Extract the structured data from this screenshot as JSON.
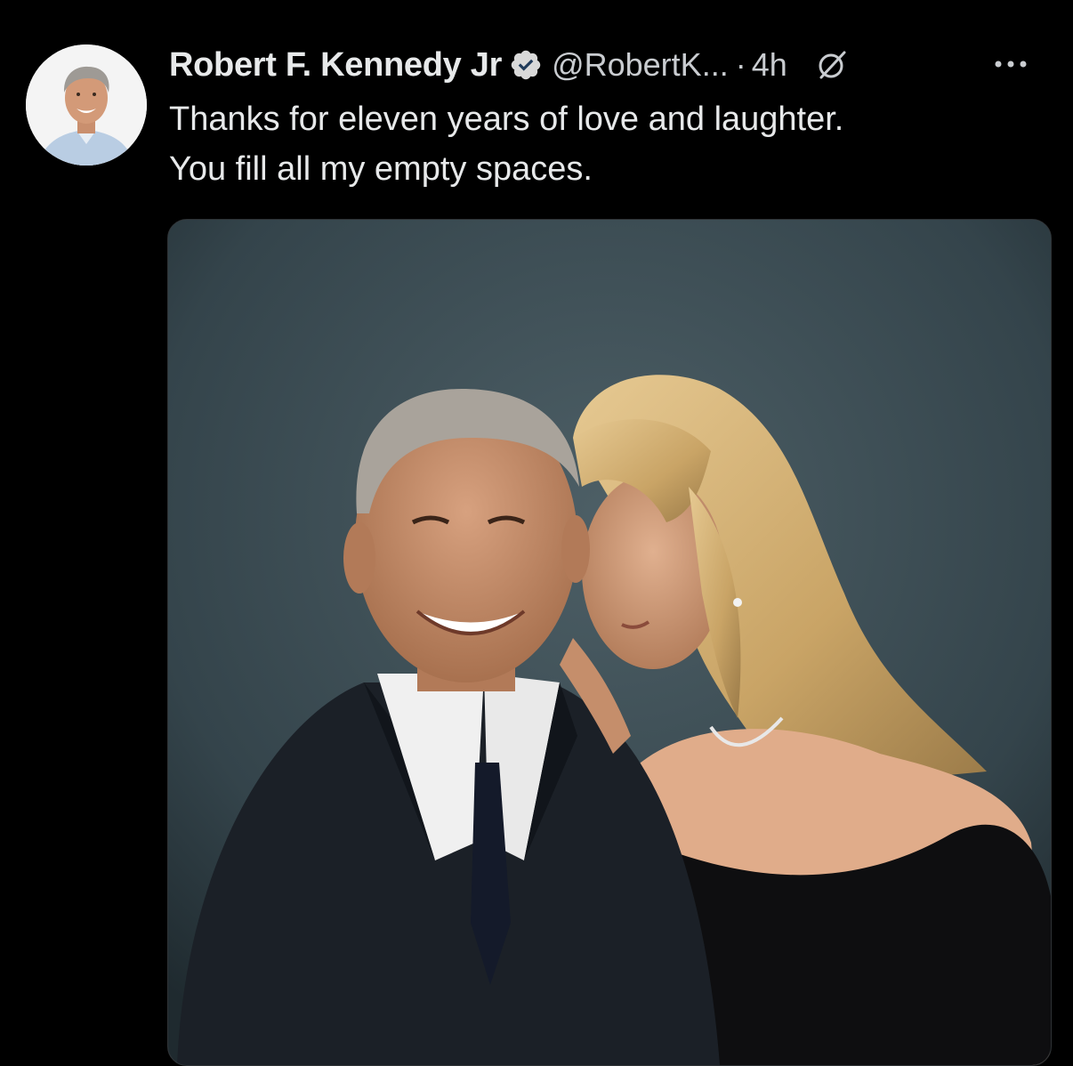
{
  "tweet": {
    "author": {
      "display_name": "Robert F. Kennedy Jr",
      "handle": "@RobertK...",
      "verified": true,
      "avatar": "profile-photo"
    },
    "separator": "·",
    "timestamp": "4h",
    "text_lines": [
      "Thanks for eleven years of love and laughter.",
      "You fill all my empty spaces."
    ],
    "media": {
      "type": "photo",
      "content": "portrait-photo"
    }
  },
  "icons": {
    "verified": "verified-badge-icon",
    "grok": "grok-icon",
    "more": "more-options-icon"
  },
  "colors": {
    "background": "#000000",
    "text_primary": "#e7e9ea",
    "text_secondary": "#c9ccd0",
    "verified_badge": "#d9d9d9"
  }
}
